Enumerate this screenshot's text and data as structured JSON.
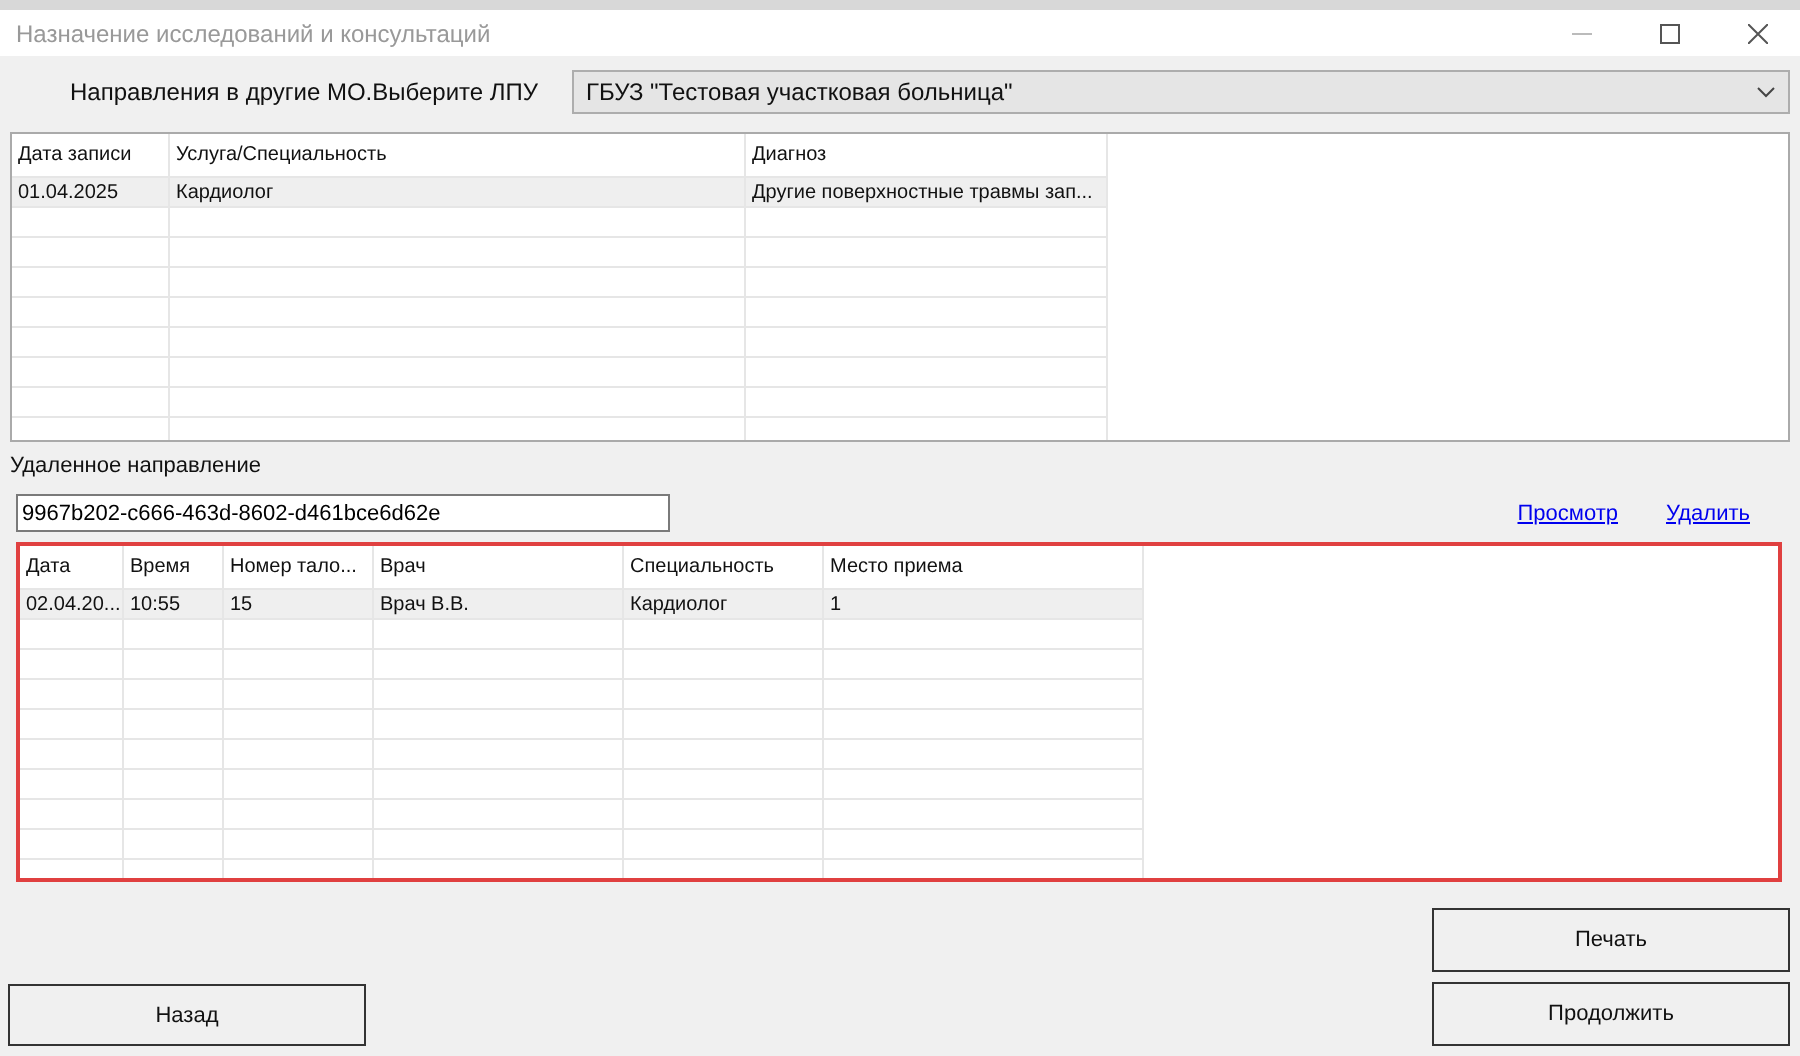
{
  "window": {
    "title": "Назначение исследований и консультаций"
  },
  "lpu": {
    "label": "Направления в другие МО.Выберите ЛПУ",
    "value": "ГБУЗ \"Тестовая участковая больница\""
  },
  "referrals_table": {
    "columns": [
      "Дата записи",
      "Услуга/Специальность",
      "Диагноз"
    ],
    "rows": [
      {
        "cells": [
          "01.04.2025",
          "Кардиолог",
          "Другие поверхностные травмы зап..."
        ],
        "selected": true
      }
    ]
  },
  "remote_referral": {
    "label": "Удаленное направление",
    "value": "9967b202-c666-463d-8602-d461bce6d62e",
    "links": [
      "Просмотр",
      "Удалить"
    ]
  },
  "appointments_table": {
    "highlighted": true,
    "columns": [
      "Дата",
      "Время",
      "Номер тало...",
      "Врач",
      "Специальность",
      "Место приема"
    ],
    "rows": [
      {
        "cells": [
          "02.04.20...",
          "10:55",
          "15",
          "Врач В.В.",
          "Кардиолог",
          "1"
        ],
        "selected": true
      }
    ]
  },
  "buttons": {
    "print": "Печать",
    "back": "Назад",
    "continue": "Продолжить"
  }
}
